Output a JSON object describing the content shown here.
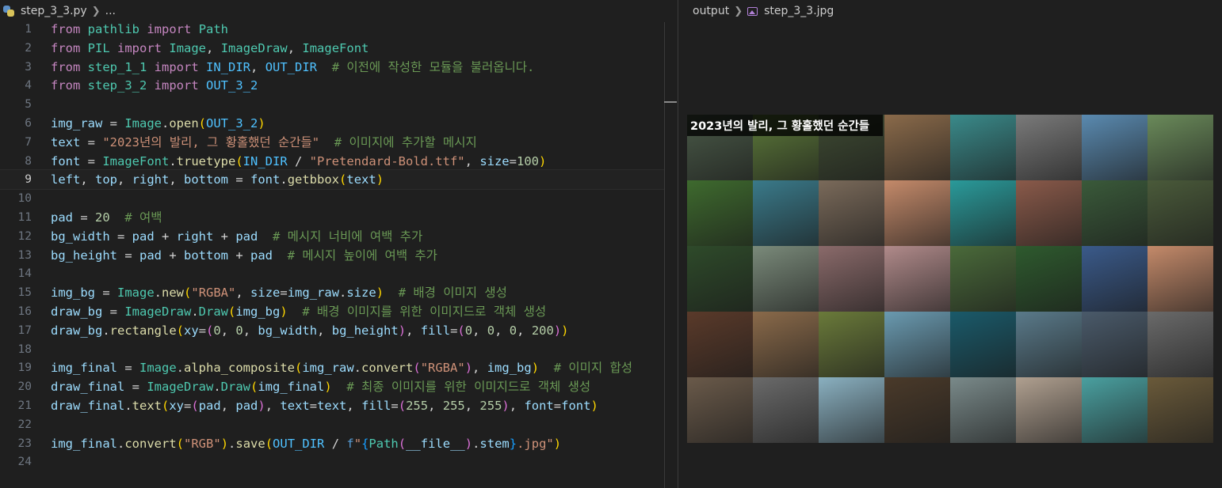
{
  "editor": {
    "filename": "step_3_3.py",
    "breadcrumb_more": "...",
    "active_line": 9,
    "lines": [
      {
        "n": "1",
        "tokens": [
          [
            "kw",
            "from"
          ],
          [
            "op",
            " "
          ],
          [
            "mod",
            "pathlib"
          ],
          [
            "op",
            " "
          ],
          [
            "kw",
            "import"
          ],
          [
            "op",
            " "
          ],
          [
            "cls",
            "Path"
          ]
        ]
      },
      {
        "n": "2",
        "tokens": [
          [
            "kw",
            "from"
          ],
          [
            "op",
            " "
          ],
          [
            "mod",
            "PIL"
          ],
          [
            "op",
            " "
          ],
          [
            "kw",
            "import"
          ],
          [
            "op",
            " "
          ],
          [
            "cls",
            "Image"
          ],
          [
            "op",
            ", "
          ],
          [
            "cls",
            "ImageDraw"
          ],
          [
            "op",
            ", "
          ],
          [
            "cls",
            "ImageFont"
          ]
        ]
      },
      {
        "n": "3",
        "tokens": [
          [
            "kw",
            "from"
          ],
          [
            "op",
            " "
          ],
          [
            "mod",
            "step_1_1"
          ],
          [
            "op",
            " "
          ],
          [
            "kw",
            "import"
          ],
          [
            "op",
            " "
          ],
          [
            "const",
            "IN_DIR"
          ],
          [
            "op",
            ", "
          ],
          [
            "const",
            "OUT_DIR"
          ],
          [
            "op",
            "  "
          ],
          [
            "cmt",
            "# 이전에 작성한 모듈을 불러옵니다."
          ]
        ]
      },
      {
        "n": "4",
        "tokens": [
          [
            "kw",
            "from"
          ],
          [
            "op",
            " "
          ],
          [
            "mod",
            "step_3_2"
          ],
          [
            "op",
            " "
          ],
          [
            "kw",
            "import"
          ],
          [
            "op",
            " "
          ],
          [
            "const",
            "OUT_3_2"
          ]
        ]
      },
      {
        "n": "5",
        "tokens": []
      },
      {
        "n": "6",
        "tokens": [
          [
            "var",
            "img_raw"
          ],
          [
            "op",
            " = "
          ],
          [
            "cls",
            "Image"
          ],
          [
            "op",
            "."
          ],
          [
            "fn",
            "open"
          ],
          [
            "p1",
            "("
          ],
          [
            "const",
            "OUT_3_2"
          ],
          [
            "p1",
            ")"
          ]
        ]
      },
      {
        "n": "7",
        "tokens": [
          [
            "var",
            "text"
          ],
          [
            "op",
            " = "
          ],
          [
            "str",
            "\"2023년의 발리, 그 황홀했던 순간들\""
          ],
          [
            "op",
            "  "
          ],
          [
            "cmt",
            "# 이미지에 추가할 메시지"
          ]
        ]
      },
      {
        "n": "8",
        "tokens": [
          [
            "var",
            "font"
          ],
          [
            "op",
            " = "
          ],
          [
            "cls",
            "ImageFont"
          ],
          [
            "op",
            "."
          ],
          [
            "fn",
            "truetype"
          ],
          [
            "p1",
            "("
          ],
          [
            "const",
            "IN_DIR"
          ],
          [
            "op",
            " / "
          ],
          [
            "str",
            "\"Pretendard-Bold.ttf\""
          ],
          [
            "op",
            ", "
          ],
          [
            "var",
            "size"
          ],
          [
            "op",
            "="
          ],
          [
            "num",
            "100"
          ],
          [
            "p1",
            ")"
          ]
        ]
      },
      {
        "n": "9",
        "tokens": [
          [
            "var",
            "left"
          ],
          [
            "op",
            ", "
          ],
          [
            "var",
            "top"
          ],
          [
            "op",
            ", "
          ],
          [
            "var",
            "right"
          ],
          [
            "op",
            ", "
          ],
          [
            "var",
            "bottom"
          ],
          [
            "op",
            " = "
          ],
          [
            "var",
            "font"
          ],
          [
            "op",
            "."
          ],
          [
            "fn",
            "getbbox"
          ],
          [
            "p1",
            "("
          ],
          [
            "var",
            "text"
          ],
          [
            "p1",
            ")"
          ]
        ]
      },
      {
        "n": "10",
        "tokens": []
      },
      {
        "n": "11",
        "tokens": [
          [
            "var",
            "pad"
          ],
          [
            "op",
            " = "
          ],
          [
            "num",
            "20"
          ],
          [
            "op",
            "  "
          ],
          [
            "cmt",
            "# 여백"
          ]
        ]
      },
      {
        "n": "12",
        "tokens": [
          [
            "var",
            "bg_width"
          ],
          [
            "op",
            " = "
          ],
          [
            "var",
            "pad"
          ],
          [
            "op",
            " + "
          ],
          [
            "var",
            "right"
          ],
          [
            "op",
            " + "
          ],
          [
            "var",
            "pad"
          ],
          [
            "op",
            "  "
          ],
          [
            "cmt",
            "# 메시지 너비에 여백 추가"
          ]
        ]
      },
      {
        "n": "13",
        "tokens": [
          [
            "var",
            "bg_height"
          ],
          [
            "op",
            " = "
          ],
          [
            "var",
            "pad"
          ],
          [
            "op",
            " + "
          ],
          [
            "var",
            "bottom"
          ],
          [
            "op",
            " + "
          ],
          [
            "var",
            "pad"
          ],
          [
            "op",
            "  "
          ],
          [
            "cmt",
            "# 메시지 높이에 여백 추가"
          ]
        ]
      },
      {
        "n": "14",
        "tokens": []
      },
      {
        "n": "15",
        "tokens": [
          [
            "var",
            "img_bg"
          ],
          [
            "op",
            " = "
          ],
          [
            "cls",
            "Image"
          ],
          [
            "op",
            "."
          ],
          [
            "fn",
            "new"
          ],
          [
            "p1",
            "("
          ],
          [
            "str",
            "\"RGBA\""
          ],
          [
            "op",
            ", "
          ],
          [
            "var",
            "size"
          ],
          [
            "op",
            "="
          ],
          [
            "var",
            "img_raw"
          ],
          [
            "op",
            "."
          ],
          [
            "var",
            "size"
          ],
          [
            "p1",
            ")"
          ],
          [
            "op",
            "  "
          ],
          [
            "cmt",
            "# 배경 이미지 생성"
          ]
        ]
      },
      {
        "n": "16",
        "tokens": [
          [
            "var",
            "draw_bg"
          ],
          [
            "op",
            " = "
          ],
          [
            "cls",
            "ImageDraw"
          ],
          [
            "op",
            "."
          ],
          [
            "cls",
            "Draw"
          ],
          [
            "p1",
            "("
          ],
          [
            "var",
            "img_bg"
          ],
          [
            "p1",
            ")"
          ],
          [
            "op",
            "  "
          ],
          [
            "cmt",
            "# 배경 이미지를 위한 이미지드로 객체 생성"
          ]
        ]
      },
      {
        "n": "17",
        "tokens": [
          [
            "var",
            "draw_bg"
          ],
          [
            "op",
            "."
          ],
          [
            "fn",
            "rectangle"
          ],
          [
            "p1",
            "("
          ],
          [
            "var",
            "xy"
          ],
          [
            "op",
            "="
          ],
          [
            "p2",
            "("
          ],
          [
            "num",
            "0"
          ],
          [
            "op",
            ", "
          ],
          [
            "num",
            "0"
          ],
          [
            "op",
            ", "
          ],
          [
            "var",
            "bg_width"
          ],
          [
            "op",
            ", "
          ],
          [
            "var",
            "bg_height"
          ],
          [
            "p2",
            ")"
          ],
          [
            "op",
            ", "
          ],
          [
            "var",
            "fill"
          ],
          [
            "op",
            "="
          ],
          [
            "p2",
            "("
          ],
          [
            "num",
            "0"
          ],
          [
            "op",
            ", "
          ],
          [
            "num",
            "0"
          ],
          [
            "op",
            ", "
          ],
          [
            "num",
            "0"
          ],
          [
            "op",
            ", "
          ],
          [
            "num",
            "200"
          ],
          [
            "p2",
            ")"
          ],
          [
            "p1",
            ")"
          ]
        ]
      },
      {
        "n": "18",
        "tokens": []
      },
      {
        "n": "19",
        "tokens": [
          [
            "var",
            "img_final"
          ],
          [
            "op",
            " = "
          ],
          [
            "cls",
            "Image"
          ],
          [
            "op",
            "."
          ],
          [
            "fn",
            "alpha_composite"
          ],
          [
            "p1",
            "("
          ],
          [
            "var",
            "img_raw"
          ],
          [
            "op",
            "."
          ],
          [
            "fn",
            "convert"
          ],
          [
            "p2",
            "("
          ],
          [
            "str",
            "\"RGBA\""
          ],
          [
            "p2",
            ")"
          ],
          [
            "op",
            ", "
          ],
          [
            "var",
            "img_bg"
          ],
          [
            "p1",
            ")"
          ],
          [
            "op",
            "  "
          ],
          [
            "cmt",
            "# 이미지 합성"
          ]
        ]
      },
      {
        "n": "20",
        "tokens": [
          [
            "var",
            "draw_final"
          ],
          [
            "op",
            " = "
          ],
          [
            "cls",
            "ImageDraw"
          ],
          [
            "op",
            "."
          ],
          [
            "cls",
            "Draw"
          ],
          [
            "p1",
            "("
          ],
          [
            "var",
            "img_final"
          ],
          [
            "p1",
            ")"
          ],
          [
            "op",
            "  "
          ],
          [
            "cmt",
            "# 최종 이미지를 위한 이미지드로 객체 생성"
          ]
        ]
      },
      {
        "n": "21",
        "tokens": [
          [
            "var",
            "draw_final"
          ],
          [
            "op",
            "."
          ],
          [
            "fn",
            "text"
          ],
          [
            "p1",
            "("
          ],
          [
            "var",
            "xy"
          ],
          [
            "op",
            "="
          ],
          [
            "p2",
            "("
          ],
          [
            "var",
            "pad"
          ],
          [
            "op",
            ", "
          ],
          [
            "var",
            "pad"
          ],
          [
            "p2",
            ")"
          ],
          [
            "op",
            ", "
          ],
          [
            "var",
            "text"
          ],
          [
            "op",
            "="
          ],
          [
            "var",
            "text"
          ],
          [
            "op",
            ", "
          ],
          [
            "var",
            "fill"
          ],
          [
            "op",
            "="
          ],
          [
            "p2",
            "("
          ],
          [
            "num",
            "255"
          ],
          [
            "op",
            ", "
          ],
          [
            "num",
            "255"
          ],
          [
            "op",
            ", "
          ],
          [
            "num",
            "255"
          ],
          [
            "p2",
            ")"
          ],
          [
            "op",
            ", "
          ],
          [
            "var",
            "font"
          ],
          [
            "op",
            "="
          ],
          [
            "var",
            "font"
          ],
          [
            "p1",
            ")"
          ]
        ]
      },
      {
        "n": "22",
        "tokens": []
      },
      {
        "n": "23",
        "tokens": [
          [
            "var",
            "img_final"
          ],
          [
            "op",
            "."
          ],
          [
            "fn",
            "convert"
          ],
          [
            "p1",
            "("
          ],
          [
            "str",
            "\"RGB\""
          ],
          [
            "p1",
            ")"
          ],
          [
            "op",
            "."
          ],
          [
            "fn",
            "save"
          ],
          [
            "p1",
            "("
          ],
          [
            "const",
            "OUT_DIR"
          ],
          [
            "op",
            " / "
          ],
          [
            "kwb",
            "f"
          ],
          [
            "str",
            "\""
          ],
          [
            "p3",
            "{"
          ],
          [
            "cls",
            "Path"
          ],
          [
            "p2",
            "("
          ],
          [
            "var",
            "__file__"
          ],
          [
            "p2",
            ")"
          ],
          [
            "op",
            "."
          ],
          [
            "var",
            "stem"
          ],
          [
            "p3",
            "}"
          ],
          [
            "str",
            ".jpg\""
          ],
          [
            "p1",
            ")"
          ]
        ]
      },
      {
        "n": "24",
        "tokens": []
      }
    ]
  },
  "preview": {
    "folder": "output",
    "filename": "step_3_3.jpg",
    "overlay_text": "2023년의 발리, 그 황홀했던 순간들",
    "tile_colors": [
      [
        "#4a5a48",
        "#5d7a3a",
        "#3e4a32",
        "#8a6a4a",
        "#3a8a8a",
        "#7a7a7a",
        "#5a8ab0",
        "#6a8a5a"
      ],
      [
        "#3e6a2e",
        "#3a7a8a",
        "#7a6a5a",
        "#c48a6a",
        "#2a9a9a",
        "#8a5a4a",
        "#3a5a3a",
        "#4a5a3a"
      ],
      [
        "#2e4a2a",
        "#7a8a7a",
        "#8a6a6a",
        "#b08a8a",
        "#4a6a3a",
        "#2e5a2e",
        "#3a5a8a",
        "#c48a6a"
      ],
      [
        "#5a3a2a",
        "#8a6a4a",
        "#6a7a3a",
        "#6a9ab0",
        "#1a5a6a",
        "#5a7a8a",
        "#4a5a6a",
        "#6a6a6a"
      ],
      [
        "#6a5a4a",
        "#6a6a6a",
        "#8ab0c0",
        "#4a3a2a",
        "#7a8a8a",
        "#b0a090",
        "#4aa0a0",
        "#6a5a3a"
      ]
    ]
  }
}
